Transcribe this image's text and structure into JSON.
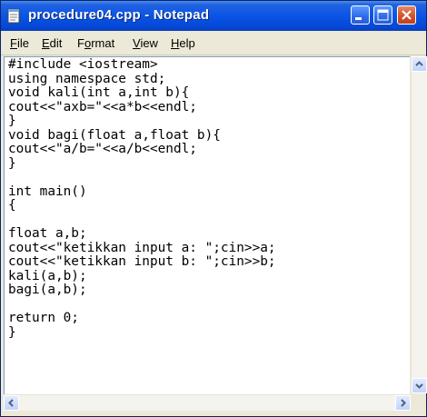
{
  "window": {
    "title": "procedure04.cpp - Notepad"
  },
  "menu": {
    "file": {
      "label": "File",
      "mnemonic": "F",
      "rest": "ile"
    },
    "edit": {
      "label": "Edit",
      "mnemonic": "E",
      "rest": "dit"
    },
    "format": {
      "label": "Format",
      "mnemonic": "o",
      "before": "F",
      "rest": "rmat"
    },
    "view": {
      "label": "View",
      "mnemonic": "V",
      "rest": "iew"
    },
    "help": {
      "label": "Help",
      "mnemonic": "H",
      "rest": "elp"
    }
  },
  "editor": {
    "text": "#include <iostream>\nusing namespace std;\nvoid kali(int a,int b){\ncout<<\"axb=\"<<a*b<<endl;\n}\nvoid bagi(float a,float b){\ncout<<\"a/b=\"<<a/b<<endl;\n}\n\nint main()\n{\n\nfloat a,b;\ncout<<\"ketikkan input a: \";cin>>a;\ncout<<\"ketikkan input b: \";cin>>b;\nkali(a,b);\nbagi(a,b);\n\nreturn 0;\n}"
  },
  "icons": {
    "app": "notepad-icon",
    "minimize": "minimize-icon",
    "maximize": "maximize-icon",
    "close": "close-icon"
  },
  "colors": {
    "titlebar": "#0a54e6",
    "close_button": "#d5532c",
    "editor_bg": "#ffffff"
  }
}
